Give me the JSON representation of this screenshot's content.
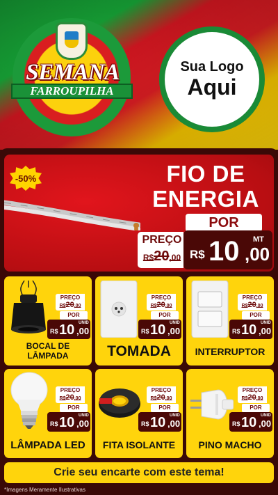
{
  "header": {
    "event_line1": "SEMANA",
    "event_line2": "FARROUPILHA",
    "logo_line1": "Sua Logo",
    "logo_line2": "Aqui"
  },
  "colors": {
    "flag_green": "#16a035",
    "flag_red": "#d61d22",
    "flag_yellow": "#ffd60a",
    "card_yellow": "#ffd40c",
    "feature_red": "#c8121a",
    "price_dark": "#4a0806"
  },
  "featured": {
    "badge": "-50%",
    "title_line1": "FIO DE",
    "title_line2": "ENERGIA",
    "por_label": "POR",
    "preco_label": "PREÇO",
    "old_prefix": "R$",
    "old_int": "20",
    "old_dec": ",00",
    "currency": "R$",
    "price_int": "10",
    "price_dec": ",00",
    "unit": "MT"
  },
  "products": [
    {
      "name_line1": "BOCAL DE",
      "name_line2": "LÂMPADA",
      "preco_label": "PREÇO",
      "old_prefix": "R$",
      "old_int": "20",
      "old_dec": ",00",
      "por_label": "POR",
      "currency": "R$",
      "price_int": "10",
      "price_dec": ",00",
      "unit": "UNID"
    },
    {
      "name_line1": "TOMADA",
      "preco_label": "PREÇO",
      "old_prefix": "R$",
      "old_int": "20",
      "old_dec": ",00",
      "por_label": "POR",
      "currency": "R$",
      "price_int": "10",
      "price_dec": ",00",
      "unit": "UNID"
    },
    {
      "name_line1": "INTERRUPTOR",
      "preco_label": "PREÇO",
      "old_prefix": "R$",
      "old_int": "20",
      "old_dec": ",00",
      "por_label": "POR",
      "currency": "R$",
      "price_int": "10",
      "price_dec": ",00",
      "unit": "UNID"
    },
    {
      "name_line1": "LÂMPADA LED",
      "preco_label": "PREÇO",
      "old_prefix": "R$",
      "old_int": "20",
      "old_dec": ",00",
      "por_label": "POR",
      "currency": "R$",
      "price_int": "10",
      "price_dec": ",00",
      "unit": "UNID"
    },
    {
      "name_line1": "FITA ISOLANTE",
      "preco_label": "PREÇO",
      "old_prefix": "R$",
      "old_int": "20",
      "old_dec": ",00",
      "por_label": "POR",
      "currency": "R$",
      "price_int": "10",
      "price_dec": ",00",
      "unit": "UNID"
    },
    {
      "name_line1": "PINO MACHO",
      "preco_label": "PREÇO",
      "old_prefix": "R$",
      "old_int": "20",
      "old_dec": ",00",
      "por_label": "POR",
      "currency": "R$",
      "price_int": "10",
      "price_dec": ",00",
      "unit": "UNID"
    }
  ],
  "footer": {
    "cta": "Crie seu encarte com este tema!",
    "disclaimer": "*Imagens Meramente Ilustrativas"
  }
}
